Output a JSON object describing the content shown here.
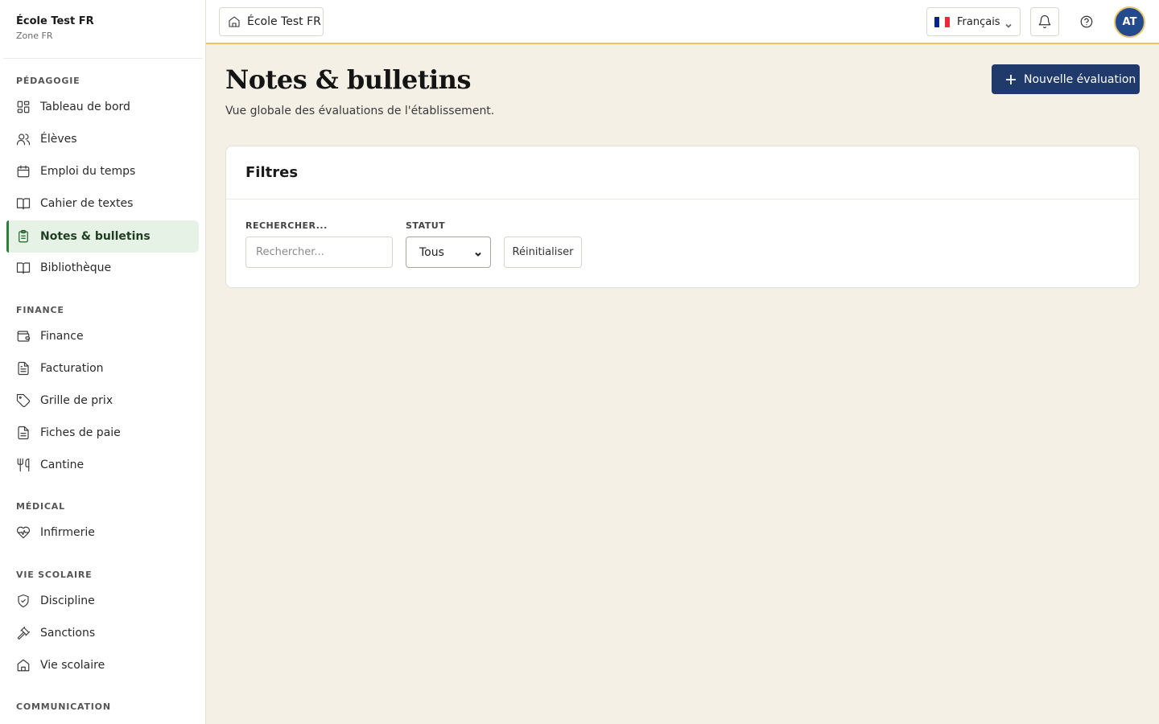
{
  "sidebar": {
    "school_name": "École Test FR",
    "zone": "Zone FR",
    "sections": [
      {
        "label": "PÉDAGOGIE",
        "items": [
          {
            "label": "Tableau de bord",
            "icon": "dashboard-icon"
          },
          {
            "label": "Élèves",
            "icon": "users-icon"
          },
          {
            "label": "Emploi du temps",
            "icon": "calendar-icon"
          },
          {
            "label": "Cahier de textes",
            "icon": "book-icon"
          },
          {
            "label": "Notes & bulletins",
            "icon": "clipboard-icon",
            "active": true
          },
          {
            "label": "Bibliothèque",
            "icon": "book-open-icon"
          }
        ]
      },
      {
        "label": "FINANCE",
        "items": [
          {
            "label": "Finance",
            "icon": "wallet-icon"
          },
          {
            "label": "Facturation",
            "icon": "file-text-icon"
          },
          {
            "label": "Grille de prix",
            "icon": "tag-icon"
          },
          {
            "label": "Fiches de paie",
            "icon": "file-icon"
          },
          {
            "label": "Cantine",
            "icon": "utensils-icon"
          }
        ]
      },
      {
        "label": "MÉDICAL",
        "items": [
          {
            "label": "Infirmerie",
            "icon": "heart-pulse-icon"
          }
        ]
      },
      {
        "label": "VIE SCOLAIRE",
        "items": [
          {
            "label": "Discipline",
            "icon": "shield-check-icon"
          },
          {
            "label": "Sanctions",
            "icon": "gavel-icon"
          },
          {
            "label": "Vie scolaire",
            "icon": "school-icon"
          }
        ]
      },
      {
        "label": "COMMUNICATION",
        "items": []
      }
    ]
  },
  "topbar": {
    "school_chip": "École Test FR",
    "language": "Français",
    "flag_colors": [
      "#002395",
      "#ffffff",
      "#ed2939"
    ],
    "avatar_initials": "AT"
  },
  "page": {
    "title": "Notes & bulletins",
    "subtitle": "Vue globale des évaluations de l'établissement.",
    "new_button": "Nouvelle évaluation"
  },
  "filters": {
    "title": "Filtres",
    "search_label": "RECHERCHER...",
    "search_placeholder": "Rechercher...",
    "search_value": "",
    "status_label": "STATUT",
    "status_value": "Tous",
    "reset_label": "Réinitialiser"
  },
  "colors": {
    "accent_green": "#2f7d3a",
    "active_bg": "#e6f2e6",
    "primary_navy": "#1f3a6b",
    "topbar_accent": "#e9c46a",
    "page_bg": "#f4f0e6"
  }
}
